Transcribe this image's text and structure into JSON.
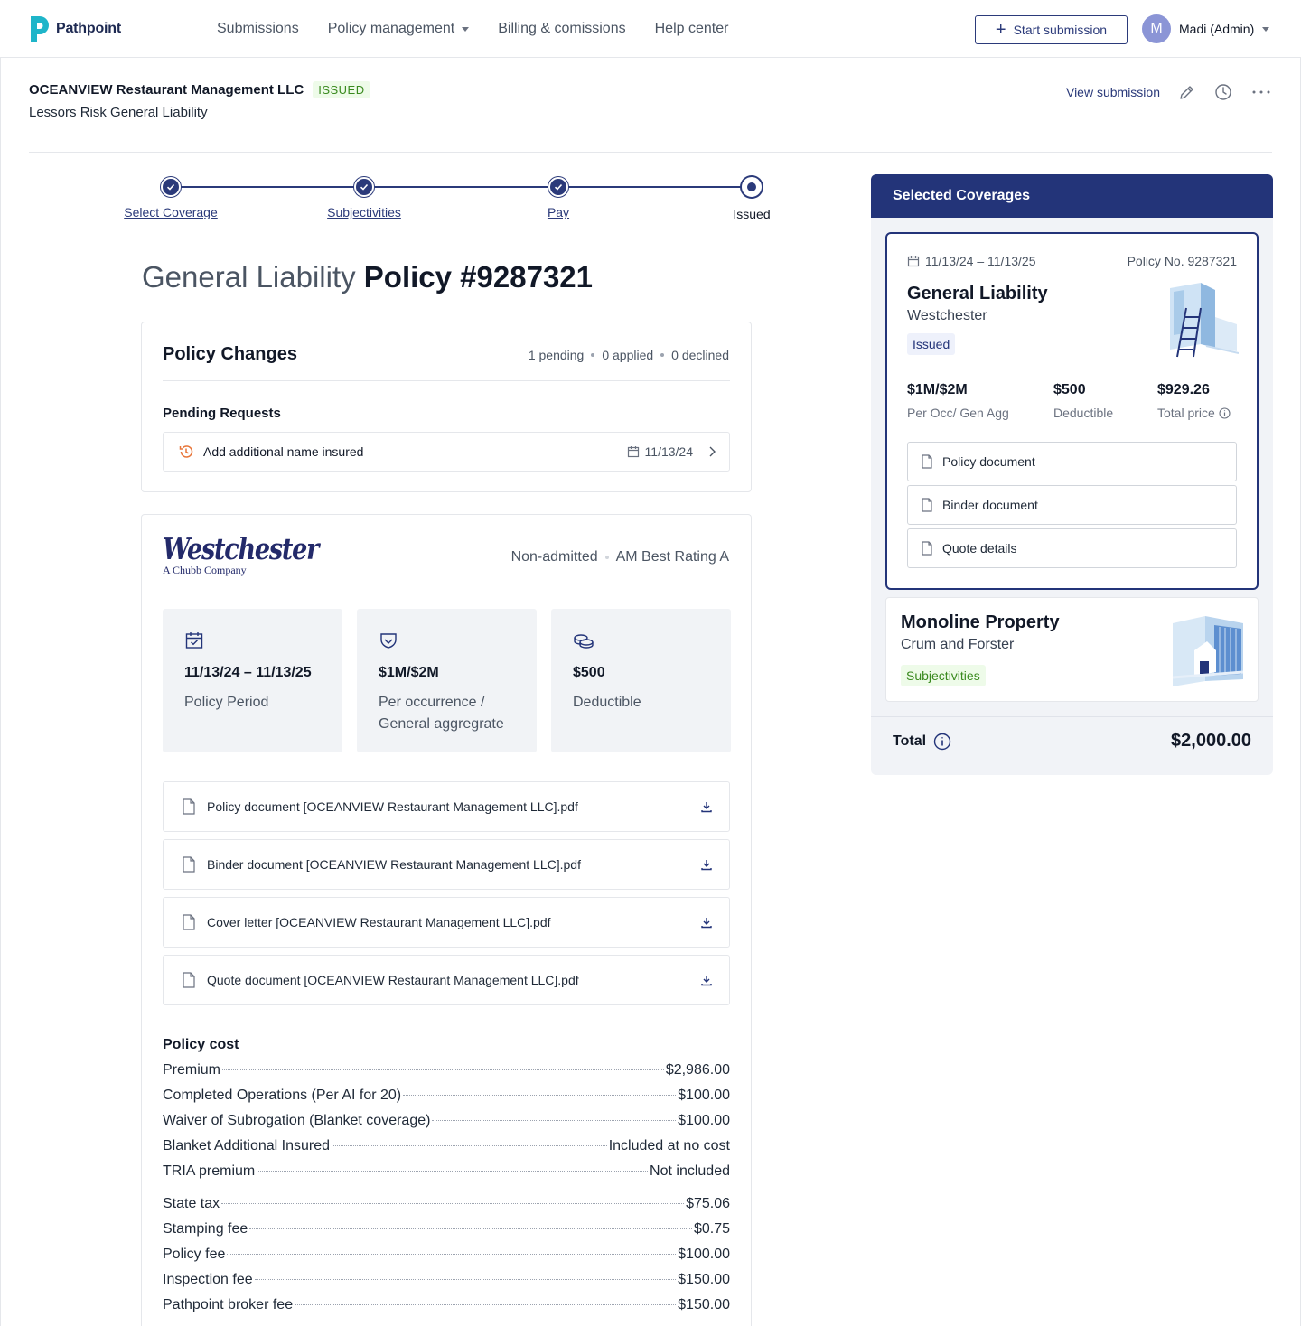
{
  "brand": {
    "name": "Pathpoint",
    "accent": "#233479",
    "logo_color": "#1fb5c9"
  },
  "nav": {
    "links": [
      "Submissions",
      "Policy management",
      "Billing & comissions",
      "Help center"
    ],
    "start_button": "Start submission",
    "user_initial": "M",
    "user_name": "Madi (Admin)"
  },
  "header": {
    "company": "OCEANVIEW Restaurant Management LLC",
    "status": "ISSUED",
    "subtitle": "Lessors Risk General Liability",
    "view_submission": "View submission"
  },
  "stepper": {
    "steps": [
      "Select Coverage",
      "Subjectivities",
      "Pay",
      "Issued"
    ],
    "current": 3
  },
  "policy_title": {
    "prefix": "General Liability",
    "number": "Policy #9287321"
  },
  "policy_changes": {
    "title": "Policy Changes",
    "pending": "1 pending",
    "applied": "0 applied",
    "declined": "0 declined",
    "pending_heading": "Pending Requests",
    "requests": [
      {
        "label": "Add additional name insured",
        "date": "11/13/24"
      }
    ]
  },
  "carrier": {
    "name": "Westchester",
    "tagline": "A Chubb Company",
    "admission": "Non-admitted",
    "rating": "AM Best Rating A",
    "tiles": [
      {
        "icon": "calendar-check-icon",
        "value": "11/13/24 – 11/13/25",
        "label": "Policy Period"
      },
      {
        "icon": "shield-icon",
        "value": "$1M/$2M",
        "label": "Per occurrence / General aggregrate"
      },
      {
        "icon": "coins-icon",
        "value": "$500",
        "label": "Deductible"
      }
    ],
    "documents": [
      "Policy document [OCEANVIEW Restaurant Management LLC].pdf",
      "Binder document [OCEANVIEW Restaurant Management LLC].pdf",
      "Cover letter [OCEANVIEW Restaurant Management LLC].pdf",
      "Quote document [OCEANVIEW Restaurant Management LLC].pdf"
    ]
  },
  "policy_cost": {
    "title": "Policy cost",
    "rows": [
      {
        "label": "Premium",
        "value": "$2,986.00"
      },
      {
        "label": "Completed Operations (Per AI for 20)",
        "value": "$100.00"
      },
      {
        "label": "Waiver of Subrogation (Blanket coverage)",
        "value": "$100.00"
      },
      {
        "label": "Blanket Additional Insured",
        "value": "Included at no cost"
      },
      {
        "label": "TRIA premium",
        "value": "Not included"
      },
      {
        "label": "State tax",
        "value": "$75.06"
      },
      {
        "label": "Stamping fee",
        "value": "$0.75"
      },
      {
        "label": "Policy fee",
        "value": "$100.00"
      },
      {
        "label": "Inspection fee",
        "value": "$150.00"
      },
      {
        "label": "Pathpoint broker fee",
        "value": "$150.00"
      }
    ]
  },
  "selected": {
    "title": "Selected Coverages",
    "gl": {
      "dates": "11/13/24 – 11/13/25",
      "policy_no": "Policy No.  9287321",
      "title": "General Liability",
      "carrier": "Westchester",
      "status": "Issued",
      "limits": "$1M/$2M",
      "limits_label": "Per Occ/ Gen Agg",
      "deductible": "$500",
      "deductible_label": "Deductible",
      "price": "$929.26",
      "price_label": "Total price",
      "docs": [
        "Policy document",
        "Binder document",
        "Quote details"
      ]
    },
    "property": {
      "title": "Monoline Property",
      "carrier": "Crum and Forster",
      "status": "Subjectivities"
    },
    "total_label": "Total",
    "total": "$2,000.00"
  }
}
